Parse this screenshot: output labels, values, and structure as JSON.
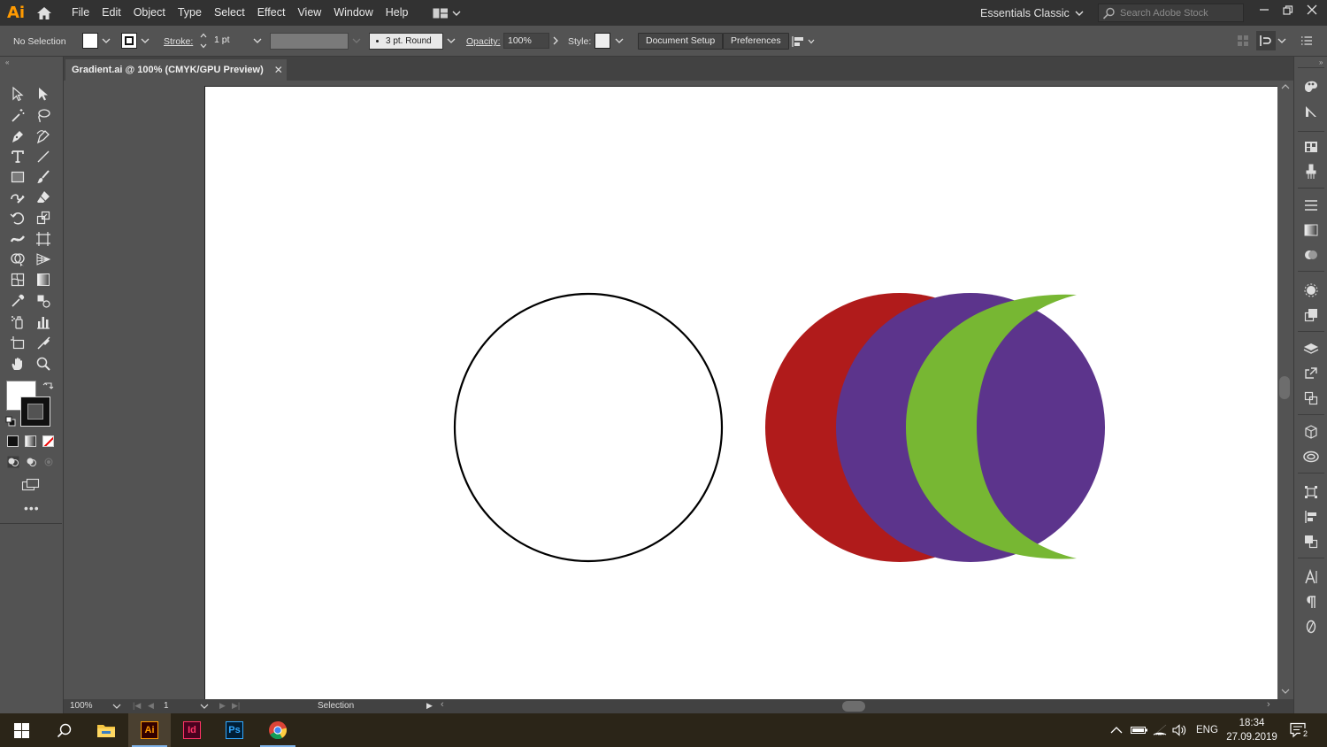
{
  "app": {
    "logo_text": "Ai",
    "brand_color": "#ff9a00",
    "menu": [
      "File",
      "Edit",
      "Object",
      "Type",
      "Select",
      "Effect",
      "View",
      "Window",
      "Help"
    ],
    "workspace": "Essentials Classic",
    "search_placeholder": "Search Adobe Stock"
  },
  "control_bar": {
    "selection_status": "No Selection",
    "stroke_label": "Stroke:",
    "stroke_weight": "1 pt",
    "brush_profile": "3 pt. Round",
    "opacity_label": "Opacity:",
    "opacity_value": "100%",
    "style_label": "Style:",
    "document_setup_label": "Document Setup",
    "preferences_label": "Preferences"
  },
  "document": {
    "tab_title": "Gradient.ai @ 100% (CMYK/GPU Preview)",
    "tab_close": "✕"
  },
  "artwork": {
    "outline_circle": {
      "stroke": "#000000",
      "fill": "#ffffff"
    },
    "crescents": [
      {
        "name": "red",
        "fill": "#b01b1b"
      },
      {
        "name": "purple",
        "fill": "#5c348c"
      },
      {
        "name": "green",
        "fill": "#77b733"
      }
    ]
  },
  "status_bar": {
    "zoom": "100%",
    "artboard_number": "1",
    "current_tool": "Selection"
  },
  "tools": [
    "selection-tool",
    "direct-selection-tool",
    "magic-wand-tool",
    "lasso-tool",
    "pen-tool",
    "curvature-tool",
    "type-tool",
    "line-segment-tool",
    "rectangle-tool",
    "paintbrush-tool",
    "shaper-tool",
    "eraser-tool",
    "rotate-tool",
    "scale-tool",
    "width-tool",
    "free-transform-tool",
    "shape-builder-tool",
    "perspective-grid-tool",
    "mesh-tool",
    "gradient-tool",
    "eyedropper-tool",
    "blend-tool",
    "symbol-sprayer-tool",
    "column-graph-tool",
    "artboard-tool",
    "slice-tool",
    "hand-tool",
    "zoom-tool"
  ],
  "taskbar": {
    "apps": [
      {
        "name": "file-explorer",
        "label": ""
      },
      {
        "name": "illustrator",
        "label": "Ai",
        "color": "#ff9a00",
        "bg": "#330000"
      },
      {
        "name": "indesign",
        "label": "Id",
        "color": "#ff3366",
        "bg": "#49021f"
      },
      {
        "name": "photoshop",
        "label": "Ps",
        "color": "#31a8ff",
        "bg": "#001e36"
      },
      {
        "name": "chrome",
        "label": ""
      }
    ],
    "language": "ENG",
    "time": "18:34",
    "date": "27.09.2019",
    "notification_count": "2"
  }
}
